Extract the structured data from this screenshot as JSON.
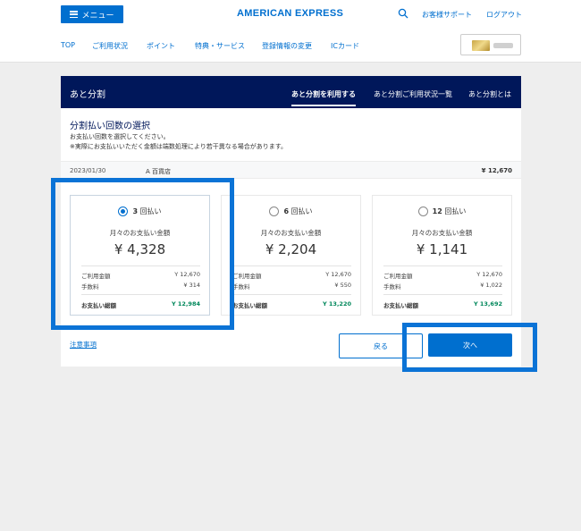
{
  "header": {
    "menu_label": "メニュー",
    "brand": "AMERICAN EXPRESS",
    "support_link": "お客様サポート",
    "logout_link": "ログアウト"
  },
  "nav": [
    "TOP",
    "ご利用状況",
    "ポイント",
    "特典・サービス",
    "登録情報の変更",
    "ICカード"
  ],
  "panel": {
    "title": "あと分割",
    "tabs": [
      "あと分割を利用する",
      "あと分割ご利用状況一覧",
      "あと分割とは"
    ]
  },
  "section": {
    "title": "分割払い回数の選択",
    "instruction_1": "お支払い回数を選択してください。",
    "instruction_2": "※実際にお支払いいただく金額は端数処理により若干異なる場合があります。"
  },
  "purchase": {
    "date": "2023/01/30",
    "store": "A 百貨店",
    "amount": "¥ 12,670"
  },
  "common": {
    "monthly_label": "月々のお支払い金額",
    "usage_label": "ご利用金額",
    "fee_label": "手数料",
    "total_label": "お支払い総額",
    "count_suffix": "回払い"
  },
  "options": [
    {
      "count": "3",
      "monthly": "¥ 4,328",
      "usage": "Y 12,670",
      "fee": "¥ 314",
      "total": "Y 12,984",
      "selected": true
    },
    {
      "count": "6",
      "monthly": "¥ 2,204",
      "usage": "Y 12,670",
      "fee": "¥ 550",
      "total": "Y 13,220",
      "selected": false
    },
    {
      "count": "12",
      "monthly": "¥ 1,141",
      "usage": "Y 12,670",
      "fee": "¥ 1,022",
      "total": "Y 13,692",
      "selected": false
    }
  ],
  "footer": {
    "notes_link": "注意事項",
    "back_button": "戻る",
    "next_button": "次へ"
  },
  "colors": {
    "accent": "#006fcf",
    "navy": "#00175a",
    "total_green": "#00875a",
    "highlight": "#0b73d6"
  }
}
